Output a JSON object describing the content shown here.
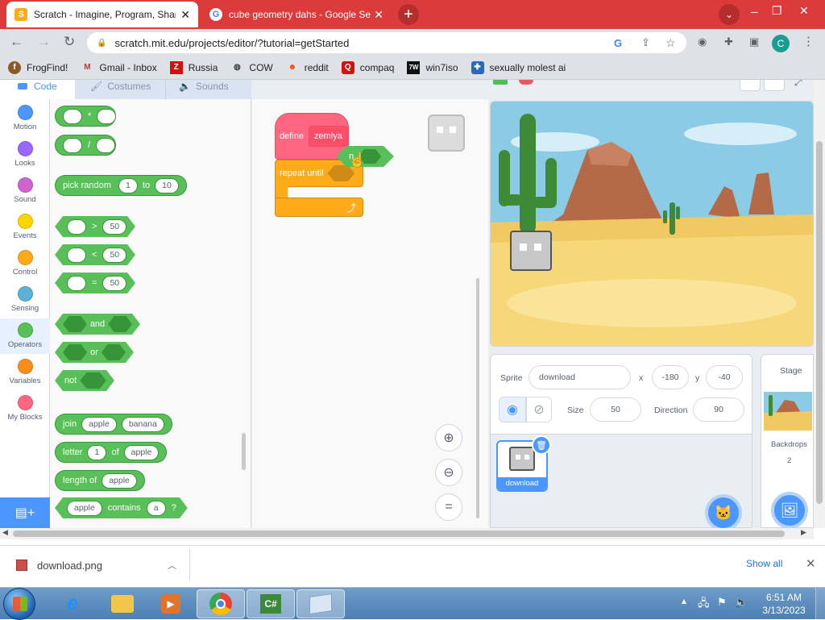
{
  "browser": {
    "tabs": [
      {
        "title": "Scratch - Imagine, Program, Shar",
        "active": true,
        "icon": "scratch-favicon"
      },
      {
        "title": "cube geometry dahs - Google Se",
        "active": false,
        "icon": "google-favicon"
      }
    ],
    "url": "scratch.mit.edu/projects/editor/?tutorial=getStarted",
    "profile_initial": "C",
    "bookmarks": [
      {
        "label": "FrogFind!",
        "icon": "frog-icon"
      },
      {
        "label": "Gmail - Inbox",
        "icon": "gmail-icon"
      },
      {
        "label": "Russia",
        "icon": "red-square-icon"
      },
      {
        "label": "COW",
        "icon": "globe-icon"
      },
      {
        "label": "reddit",
        "icon": "reddit-icon"
      },
      {
        "label": "compaq",
        "icon": "compaq-icon"
      },
      {
        "label": "win7iso",
        "icon": "win-icon"
      },
      {
        "label": "sexually molest ai",
        "icon": "puzzle-icon"
      }
    ]
  },
  "editor": {
    "tabs": [
      "Code",
      "Costumes",
      "Sounds"
    ],
    "categories": [
      {
        "label": "Motion",
        "color": "#4c97ff"
      },
      {
        "label": "Looks",
        "color": "#9966ff"
      },
      {
        "label": "Sound",
        "color": "#cf63cf"
      },
      {
        "label": "Events",
        "color": "#ffd500"
      },
      {
        "label": "Control",
        "color": "#ffab19"
      },
      {
        "label": "Sensing",
        "color": "#5cb1d6"
      },
      {
        "label": "Operators",
        "color": "#59c059"
      },
      {
        "label": "Variables",
        "color": "#ff8c1a"
      },
      {
        "label": "My Blocks",
        "color": "#ff6680"
      }
    ],
    "palette": {
      "multiply": "*",
      "divide": "/",
      "pick_random": "pick random",
      "pick_from": "1",
      "pick_to_word": "to",
      "pick_to": "10",
      "gt_sym": ">",
      "gt_val": "50",
      "lt_sym": "<",
      "lt_val": "50",
      "eq_sym": "=",
      "eq_val": "50",
      "and": "and",
      "or": "or",
      "not": "not",
      "join": "join",
      "join_a": "apple",
      "join_b": "banana",
      "letter": "letter",
      "letter_n": "1",
      "letter_of": "of",
      "letter_s": "apple",
      "length_of": "length of",
      "length_s": "apple",
      "contains_a": "apple",
      "contains": "contains",
      "contains_b": "a",
      "contains_q": "?"
    },
    "script": {
      "define": "define",
      "block_name": "zemlya",
      "repeat_until": "repeat until",
      "dragged": "n"
    }
  },
  "stage_panel": {
    "sprite_label": "Sprite",
    "sprite_name": "download",
    "x_label": "x",
    "x": "-180",
    "y_label": "y",
    "y": "-40",
    "size_label": "Size",
    "size": "50",
    "direction_label": "Direction",
    "direction": "90",
    "sprite_thumb_label": "download",
    "stage_label": "Stage",
    "backdrops_label": "Backdrops",
    "backdrops_count": "2"
  },
  "download_bar": {
    "file": "download.png",
    "show_all": "Show all"
  },
  "taskbar": {
    "time": "6:51 AM",
    "date": "3/13/2023"
  },
  "colors": {
    "chrome_red": "#dc3b3b",
    "operators_green": "#59c059",
    "myblocks_pink": "#ff6680",
    "control_orange": "#ffab19",
    "scratch_blue": "#4c97ff"
  }
}
